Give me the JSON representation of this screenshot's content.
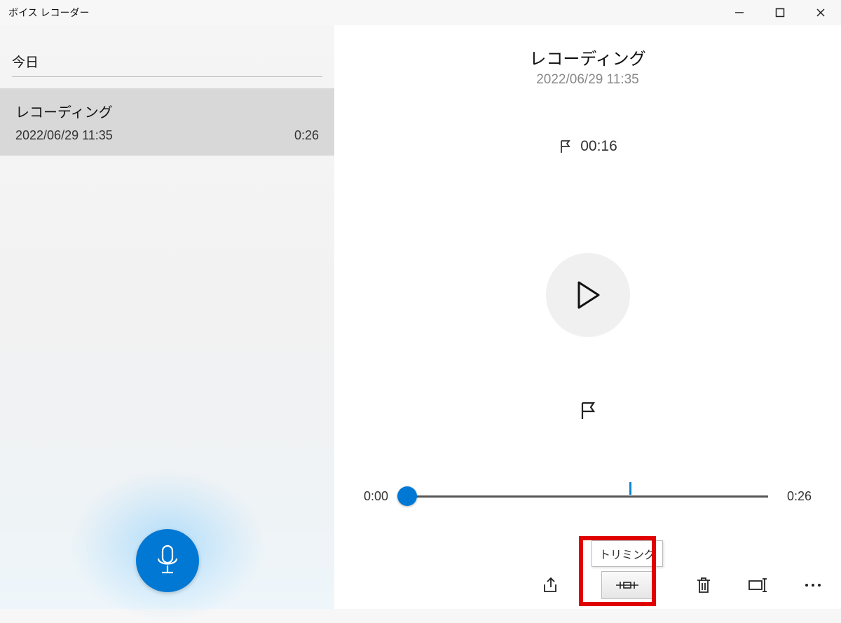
{
  "app": {
    "title": "ボイス レコーダー"
  },
  "sidebar": {
    "section_label": "今日",
    "items": [
      {
        "title": "レコーディング",
        "date": "2022/06/29 11:35",
        "duration": "0:26"
      }
    ]
  },
  "detail": {
    "title": "レコーディング",
    "subtitle": "2022/06/29 11:35",
    "marker_time": "00:16",
    "timeline_start": "0:00",
    "timeline_end": "0:26"
  },
  "toolbar": {
    "trim_tooltip": "トリミング"
  },
  "colors": {
    "accent": "#0078d4",
    "highlight_border": "#e00000"
  }
}
